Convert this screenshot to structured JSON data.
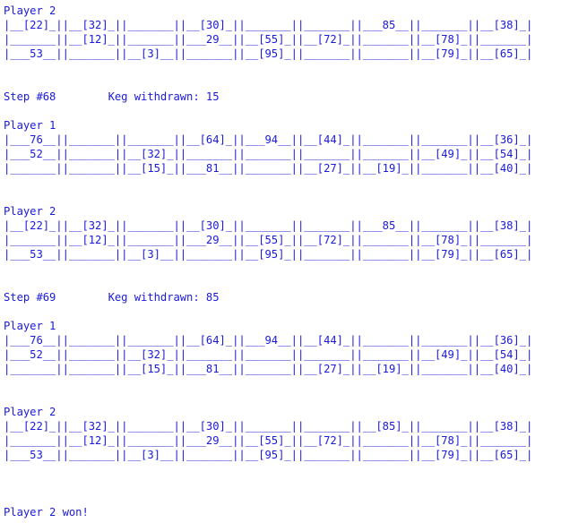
{
  "lines": [
    "Player 2",
    "|__[22]_||__[32]_||_______||__[30]_||_______||_______||___85__||_______||__[38]_|",
    "|_______||__[12]_||_______||___29__||__[55]_||__[72]_||_______||__[78]_||_______|",
    "|___53__||_______||__[3]__||_______||__[95]_||_______||_______||__[79]_||__[65]_|",
    "Step #68        Keg withdrawn: 15",
    "Player 1",
    "|___76__||_______||_______||__[64]_||___94__||__[44]_||_______||_______||__[36]_|",
    "|___52__||_______||__[32]_||_______||_______||_______||_______||__[49]_||__[54]_|",
    "|_______||_______||__[15]_||___81__||_______||__[27]_||__[19]_||_______||__[40]_|",
    "Player 2",
    "|__[22]_||__[32]_||_______||__[30]_||_______||_______||___85__||_______||__[38]_|",
    "|_______||__[12]_||_______||___29__||__[55]_||__[72]_||_______||__[78]_||_______|",
    "|___53__||_______||__[3]__||_______||__[95]_||_______||_______||__[79]_||__[65]_|",
    "Step #69        Keg withdrawn: 85",
    "Player 1",
    "|___76__||_______||_______||__[64]_||___94__||__[44]_||_______||_______||__[36]_|",
    "|___52__||_______||__[32]_||_______||_______||_______||_______||__[49]_||__[54]_|",
    "|_______||_______||__[15]_||___81__||_______||__[27]_||__[19]_||_______||__[40]_|",
    "Player 2",
    "|__[22]_||__[32]_||_______||__[30]_||_______||_______||__[85]_||_______||__[38]_|",
    "|_______||__[12]_||_______||___29__||__[55]_||__[72]_||_______||__[78]_||_______|",
    "|___53__||_______||__[3]__||_______||__[95]_||_______||_______||__[79]_||__[65]_|",
    "Player 2 won!"
  ]
}
